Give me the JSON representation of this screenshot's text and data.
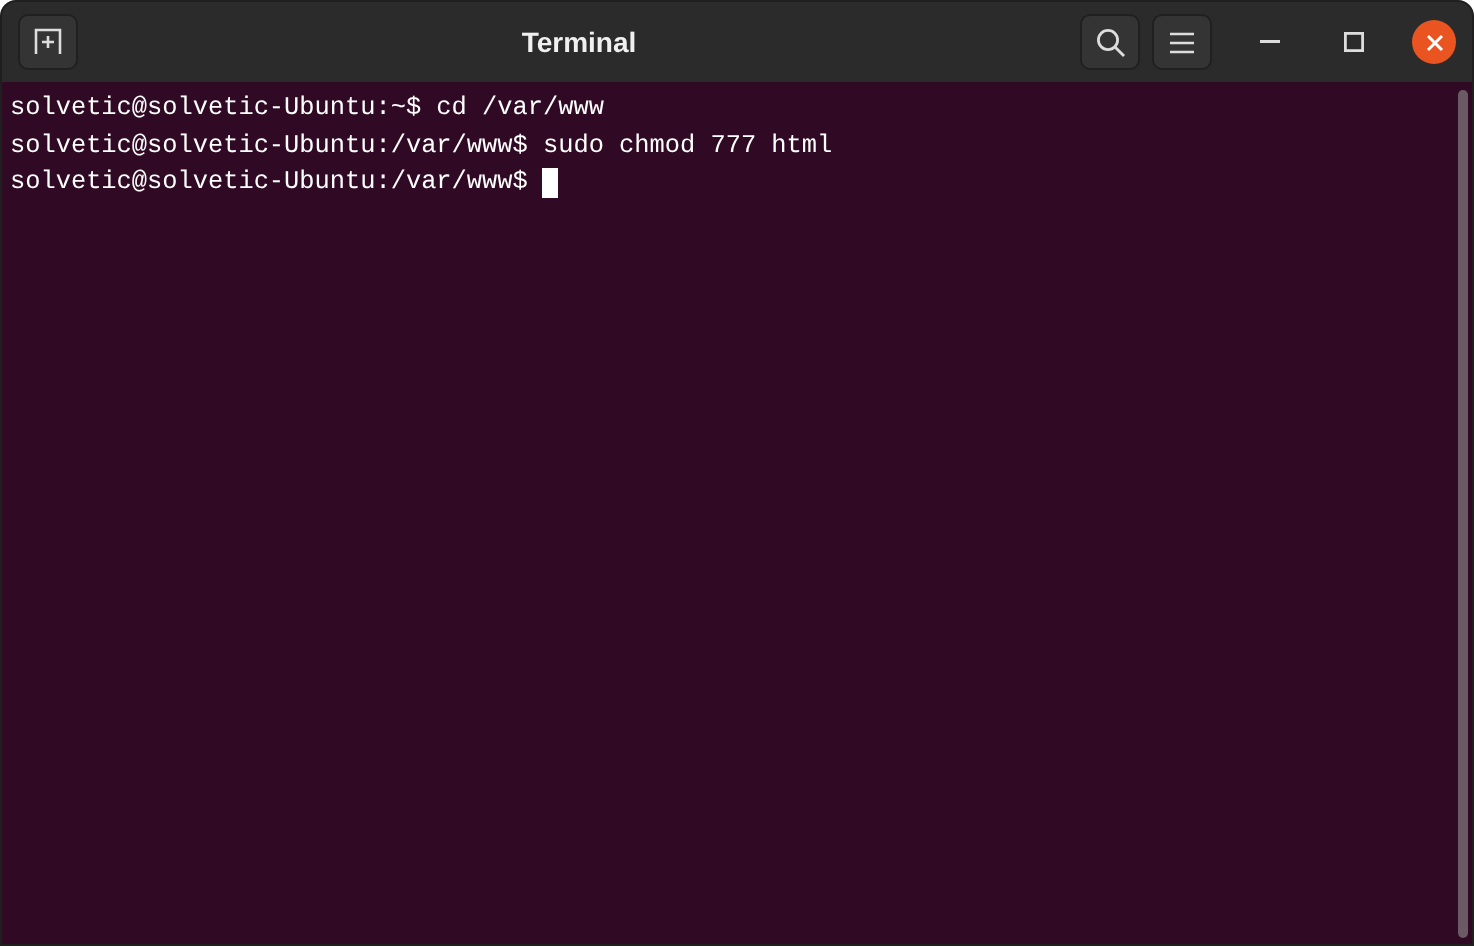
{
  "window": {
    "title": "Terminal"
  },
  "lines": [
    {
      "text": "solvetic@solvetic-Ubuntu:~$ cd /var/www",
      "cursor": false
    },
    {
      "text": "solvetic@solvetic-Ubuntu:/var/www$ sudo chmod 777 html",
      "cursor": false
    },
    {
      "text": "solvetic@solvetic-Ubuntu:/var/www$ ",
      "cursor": true
    }
  ]
}
